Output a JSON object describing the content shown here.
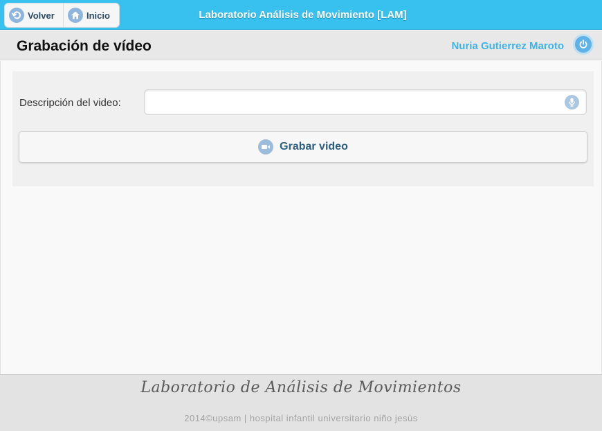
{
  "app": {
    "title": "Laboratorio Análisis de Movimiento [LAM]"
  },
  "nav": {
    "back_label": "Volver",
    "back_icon": "back-arrow-icon",
    "home_label": "Inicio",
    "home_icon": "home-icon"
  },
  "header": {
    "page_title": "Grabación de vídeo",
    "user_name": "Nuria Gutierrez Maroto",
    "logout_icon": "power-icon"
  },
  "form": {
    "description_label": "Descripción del video:",
    "description_value": "",
    "description_placeholder": "",
    "mic_icon": "microphone-icon",
    "record_label": "Grabar video",
    "record_icon": "video-camera-icon"
  },
  "footer": {
    "brand": "Laboratorio de Análisis de Movimientos",
    "copyright": "2014©upsam | hospital infantil universitario niño jesùs"
  },
  "colors": {
    "topbar": "#38c0ef",
    "accent_text": "#3fb3e8",
    "button_text": "#2e5e80",
    "icon_circle": "#8db5de"
  }
}
